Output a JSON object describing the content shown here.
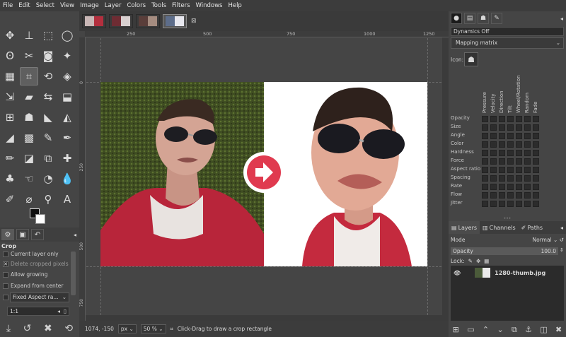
{
  "menu": [
    "File",
    "Edit",
    "Select",
    "View",
    "Image",
    "Layer",
    "Colors",
    "Tools",
    "Filters",
    "Windows",
    "Help"
  ],
  "image_tabs": {
    "close_glyph": "⊠"
  },
  "tools": [
    {
      "name": "move-tool-icon",
      "glyph": "✥"
    },
    {
      "name": "align-tool-icon",
      "glyph": "⊥"
    },
    {
      "name": "rect-select-icon",
      "glyph": "⬚"
    },
    {
      "name": "ellipse-select-icon",
      "glyph": "◯"
    },
    {
      "name": "free-select-icon",
      "glyph": "ʘ"
    },
    {
      "name": "scissors-select-icon",
      "glyph": "✂"
    },
    {
      "name": "foreground-select-icon",
      "glyph": "◙"
    },
    {
      "name": "fuzzy-select-icon",
      "glyph": "✦"
    },
    {
      "name": "by-color-select-icon",
      "glyph": "▦"
    },
    {
      "name": "crop-tool-icon",
      "glyph": "⌗"
    },
    {
      "name": "unified-transform-icon",
      "glyph": "⟲"
    },
    {
      "name": "warp-transform-icon",
      "glyph": "◈"
    },
    {
      "name": "scale-tool-icon",
      "glyph": "⇲"
    },
    {
      "name": "shear-tool-icon",
      "glyph": "▰"
    },
    {
      "name": "flip-tool-icon",
      "glyph": "⇆"
    },
    {
      "name": "perspective-tool-icon",
      "glyph": "⬓"
    },
    {
      "name": "cage-transform-icon",
      "glyph": "⊞"
    },
    {
      "name": "handle-transform-icon",
      "glyph": "☗"
    },
    {
      "name": "bucket-fill-icon",
      "glyph": "◣"
    },
    {
      "name": "gradient-tool-icon",
      "glyph": "◭"
    },
    {
      "name": "paintbrush-tool-icon",
      "glyph": "◢"
    },
    {
      "name": "mypaint-brush-icon",
      "glyph": "▩"
    },
    {
      "name": "airbrush-tool-icon",
      "glyph": "✎"
    },
    {
      "name": "ink-tool-icon",
      "glyph": "✒"
    },
    {
      "name": "pencil-tool-icon",
      "glyph": "✏"
    },
    {
      "name": "eraser-tool-icon",
      "glyph": "◪"
    },
    {
      "name": "clone-tool-icon",
      "glyph": "⧉"
    },
    {
      "name": "heal-tool-icon",
      "glyph": "✚"
    },
    {
      "name": "perspective-clone-icon",
      "glyph": "♣"
    },
    {
      "name": "smudge-tool-icon",
      "glyph": "☜"
    },
    {
      "name": "dodge-burn-icon",
      "glyph": "◔"
    },
    {
      "name": "blur-sharpen-icon",
      "glyph": "💧"
    },
    {
      "name": "paths-tool-icon",
      "glyph": "✐"
    },
    {
      "name": "color-picker-icon",
      "glyph": "⌀"
    },
    {
      "name": "zoom-tool-icon",
      "glyph": "⚲"
    },
    {
      "name": "text-tool-icon",
      "glyph": "A"
    }
  ],
  "tool_options": {
    "title": "Crop",
    "current_layer_only": "Current layer only",
    "delete_cropped_pixels": "Delete cropped pixels",
    "allow_growing": "Allow growing",
    "expand_from_center": "Expand from center",
    "fixed_mode": "Fixed Aspect ra...",
    "ratio_value": "1:1"
  },
  "status": {
    "coords": "1074, -150",
    "unit": "px",
    "zoom": "50 %",
    "message": "Click-Drag to draw a crop rectangle"
  },
  "rulers": {
    "h": [
      "250",
      "500",
      "750",
      "1000",
      "1250"
    ],
    "v": [
      "0",
      "250",
      "500",
      "750"
    ]
  },
  "dynamics": {
    "name": "Dynamics Off",
    "matrix_label": "Mapping matrix",
    "icon_label": "Icon:",
    "columns": [
      "Pressure",
      "Velocity",
      "Direction",
      "Tilt",
      "Wheel/Rotation",
      "Random",
      "Fade"
    ],
    "rows": [
      "Opacity",
      "Size",
      "Angle",
      "Color",
      "Hardness",
      "Force",
      "Aspect ratio",
      "Spacing",
      "Rate",
      "Flow",
      "Jitter"
    ]
  },
  "layers_panel": {
    "tabs": [
      "Layers",
      "Channels",
      "Paths"
    ],
    "mode_label": "Mode",
    "mode_value": "Normal",
    "opacity_label": "Opacity",
    "opacity_value": "100.0",
    "lock_label": "Lock:",
    "layer_name": "1280-thumb.jpg"
  },
  "colors": {
    "accent_red": "#e03a4f",
    "canvas_bg": "#454545",
    "fg": "#111111",
    "bg": "#ffffff"
  }
}
